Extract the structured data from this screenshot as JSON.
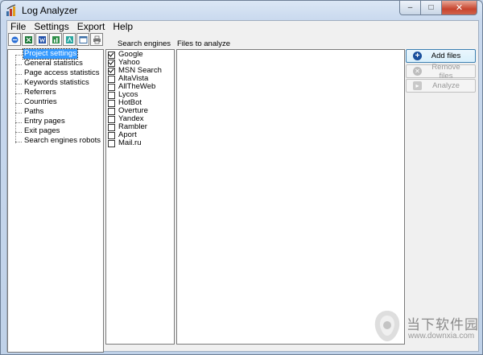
{
  "window": {
    "title": "Log Analyzer"
  },
  "caption_buttons": {
    "minimize": "–",
    "maximize": "□",
    "close": "✕"
  },
  "menu": [
    "File",
    "Settings",
    "Export",
    "Help"
  ],
  "toolbar": {
    "icons": [
      "ie-export-icon",
      "excel-export-icon",
      "word-export-icon",
      "excel-chart-icon",
      "pdf-export-icon",
      "web-page-icon",
      "print-icon"
    ]
  },
  "tree": {
    "items": [
      {
        "label": "Project settings",
        "selected": true
      },
      {
        "label": "General statistics",
        "selected": false
      },
      {
        "label": "Page access statistics",
        "selected": false
      },
      {
        "label": "Keywords statistics",
        "selected": false
      },
      {
        "label": "Referrers",
        "selected": false
      },
      {
        "label": "Countries",
        "selected": false
      },
      {
        "label": "Paths",
        "selected": false
      },
      {
        "label": "Entry pages",
        "selected": false
      },
      {
        "label": "Exit pages",
        "selected": false
      },
      {
        "label": "Search engines robots",
        "selected": false
      }
    ]
  },
  "search_engines": {
    "header": "Search engines",
    "items": [
      {
        "label": "Google",
        "checked": true
      },
      {
        "label": "Yahoo",
        "checked": true
      },
      {
        "label": "MSN Search",
        "checked": true
      },
      {
        "label": "AltaVista",
        "checked": false
      },
      {
        "label": "AllTheWeb",
        "checked": false
      },
      {
        "label": "Lycos",
        "checked": false
      },
      {
        "label": "HotBot",
        "checked": false
      },
      {
        "label": "Overture",
        "checked": false
      },
      {
        "label": "Yandex",
        "checked": false
      },
      {
        "label": "Rambler",
        "checked": false
      },
      {
        "label": "Aport",
        "checked": false
      },
      {
        "label": "Mail.ru",
        "checked": false
      }
    ]
  },
  "files": {
    "header": "Files to analyze",
    "items": []
  },
  "actions": {
    "add_files": "Add files",
    "remove_files": "Remove files",
    "analyze": "Analyze"
  },
  "watermark": {
    "brand": "当下软件园",
    "url": "www.downxia.com"
  },
  "colors": {
    "selection": "#3399ff",
    "window_frame": "#c9d9ee",
    "close_button": "#c7452f"
  }
}
